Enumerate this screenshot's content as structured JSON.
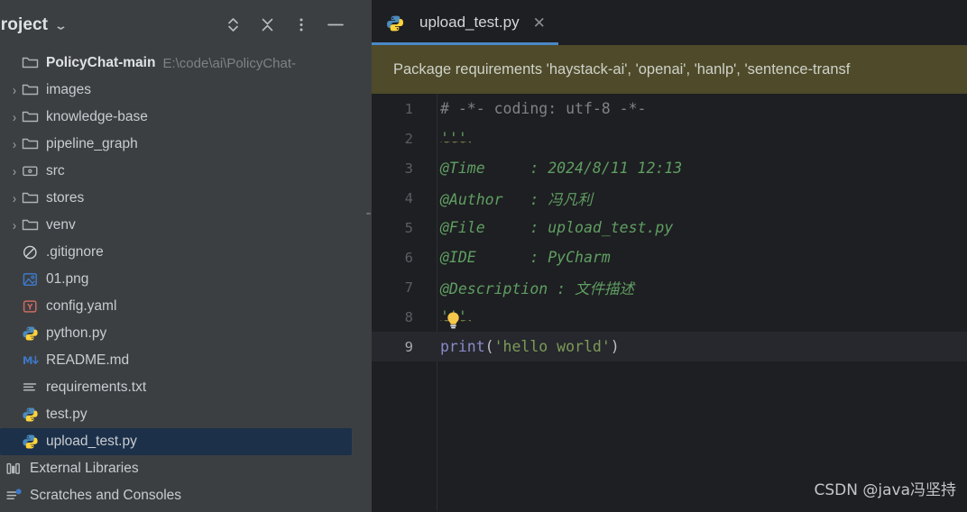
{
  "sidebar": {
    "title": "Project",
    "title_dropdown_icon": "chevron-down-icon",
    "header_buttons": [
      {
        "name": "expand-collapse-icon",
        "tooltip": "Expand or Collapse"
      },
      {
        "name": "collapse-all-icon",
        "tooltip": "Collapse All"
      },
      {
        "name": "more-options-icon",
        "tooltip": "Options"
      },
      {
        "name": "minimize-icon",
        "tooltip": "Hide"
      }
    ],
    "tree": [
      {
        "label": "PolicyChat-main",
        "path": "E:\\code\\ai\\PolicyChat-",
        "icon": "folder-open-icon",
        "arrow": "down",
        "level": 0,
        "bold": true,
        "selected": false
      },
      {
        "label": "images",
        "icon": "folder-icon",
        "arrow": "right",
        "level": 1,
        "selected": false
      },
      {
        "label": "knowledge-base",
        "icon": "folder-icon",
        "arrow": "right",
        "level": 1,
        "selected": false
      },
      {
        "label": "pipeline_graph",
        "icon": "folder-icon",
        "arrow": "right",
        "level": 1,
        "selected": false
      },
      {
        "label": "src",
        "icon": "sources-root-folder-icon",
        "arrow": "right",
        "level": 1,
        "selected": false
      },
      {
        "label": "stores",
        "icon": "folder-icon",
        "arrow": "right",
        "level": 1,
        "selected": false
      },
      {
        "label": "venv",
        "icon": "folder-icon",
        "arrow": "right",
        "level": 1,
        "selected": false
      },
      {
        "label": ".gitignore",
        "icon": "gitignore-icon",
        "arrow": "none",
        "level": 2,
        "selected": false
      },
      {
        "label": "01.png",
        "icon": "image-file-icon",
        "arrow": "none",
        "level": 2,
        "selected": false
      },
      {
        "label": "config.yaml",
        "icon": "yaml-file-icon",
        "arrow": "none",
        "level": 2,
        "selected": false
      },
      {
        "label": "python.py",
        "icon": "python-file-icon",
        "arrow": "none",
        "level": 2,
        "selected": false
      },
      {
        "label": "README.md",
        "icon": "markdown-file-icon",
        "arrow": "none",
        "level": 2,
        "selected": false
      },
      {
        "label": "requirements.txt",
        "icon": "text-file-icon",
        "arrow": "none",
        "level": 2,
        "selected": false
      },
      {
        "label": "test.py",
        "icon": "python-file-icon",
        "arrow": "none",
        "level": 2,
        "selected": false
      },
      {
        "label": "upload_test.py",
        "icon": "python-file-icon",
        "arrow": "none",
        "level": 2,
        "selected": true
      },
      {
        "label": "External Libraries",
        "icon": "library-icon",
        "arrow": "none",
        "level": 0,
        "selected": false
      },
      {
        "label": "Scratches and Consoles",
        "icon": "scratches-icon",
        "arrow": "none",
        "level": 0,
        "selected": false
      }
    ]
  },
  "editor": {
    "tabs": [
      {
        "label": "upload_test.py",
        "icon": "python-file-icon",
        "active": true,
        "close_icon": "close-icon"
      }
    ],
    "banner": {
      "text": "Package requirements 'haystack-ai', 'openai', 'hanlp', 'sentence-transf",
      "background": "#4e4a2a"
    },
    "lines": [
      {
        "n": "1",
        "current": false,
        "tokens": [
          {
            "t": "# -*- coding: utf-8 -*-",
            "c": "tok-comment"
          }
        ]
      },
      {
        "n": "2",
        "current": false,
        "squiggle": true,
        "tokens": [
          {
            "t": "'''",
            "c": "tok-doc"
          }
        ]
      },
      {
        "n": "3",
        "current": false,
        "tokens": [
          {
            "t": "@Time     : 2024/8/11 12:13",
            "c": "tok-doc"
          }
        ]
      },
      {
        "n": "4",
        "current": false,
        "tokens": [
          {
            "t": "@Author   : ",
            "c": "tok-doc"
          },
          {
            "t": "冯凡利",
            "c": "tok-doc-cn"
          }
        ]
      },
      {
        "n": "5",
        "current": false,
        "tokens": [
          {
            "t": "@File     : upload_test.py",
            "c": "tok-doc"
          }
        ]
      },
      {
        "n": "6",
        "current": false,
        "tokens": [
          {
            "t": "@IDE      : PyCharm",
            "c": "tok-doc"
          }
        ]
      },
      {
        "n": "7",
        "current": false,
        "tokens": [
          {
            "t": "@Description : ",
            "c": "tok-doc"
          },
          {
            "t": "文件描述",
            "c": "tok-doc-cn"
          }
        ]
      },
      {
        "n": "8",
        "current": false,
        "squiggle": true,
        "bulb": true,
        "tokens": [
          {
            "t": "'''",
            "c": "tok-doc"
          }
        ]
      },
      {
        "n": "9",
        "current": true,
        "tokens": [
          {
            "t": "print",
            "c": "tok-fn"
          },
          {
            "t": "(",
            "c": "tok-paren"
          },
          {
            "t": "'hello world'",
            "c": "tok-str"
          },
          {
            "t": ")",
            "c": "tok-paren"
          }
        ]
      }
    ]
  },
  "watermark": {
    "text": "CSDN @java冯坚持"
  },
  "colors": {
    "sidebar_bg": "#3c3f41",
    "editor_bg": "#1e1f22",
    "selection_bg": "#1c3049",
    "tab_underline": "#4a88c7",
    "banner_bg": "#4e4a2a",
    "current_line_bg": "#26282e",
    "doc_green": "#5f9e62",
    "string_olive": "#7e9a56",
    "keyword_violet": "#8a8ac6"
  }
}
